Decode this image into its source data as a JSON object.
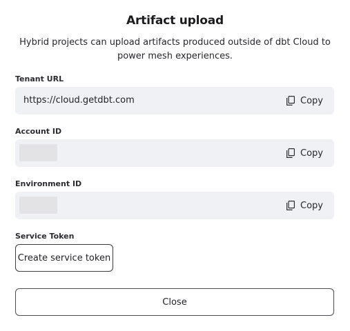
{
  "dialog": {
    "title": "Artifact upload",
    "description": "Hybrid projects can upload artifacts produced outside of dbt Cloud to power mesh experiences."
  },
  "fields": {
    "tenant_url": {
      "label": "Tenant URL",
      "value": "https://cloud.getdbt.com",
      "copy_label": "Copy"
    },
    "account_id": {
      "label": "Account ID",
      "value": "",
      "copy_label": "Copy"
    },
    "environment_id": {
      "label": "Environment ID",
      "value": "",
      "copy_label": "Copy"
    }
  },
  "service_token": {
    "label": "Service Token",
    "button_label": "Create service token"
  },
  "footer": {
    "close_label": "Close"
  },
  "icons": {
    "copy": "copy-icon"
  }
}
